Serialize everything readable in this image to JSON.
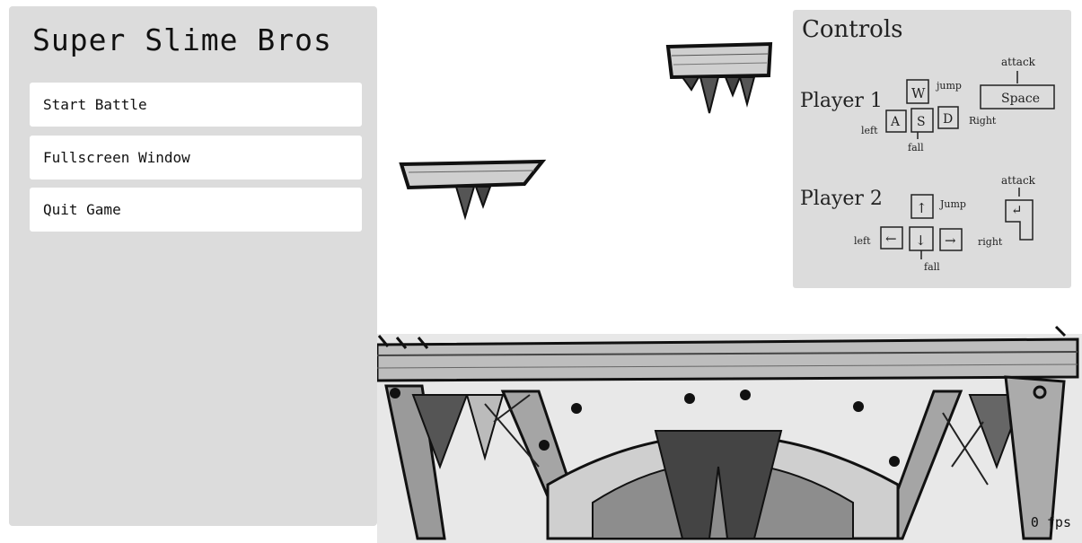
{
  "menu": {
    "title": "Super Slime Bros",
    "buttons": [
      {
        "label": "Start Battle"
      },
      {
        "label": "Fullscreen Window"
      },
      {
        "label": "Quit Game"
      }
    ]
  },
  "controls": {
    "title": "Controls",
    "player1": {
      "label": "Player 1",
      "keys": {
        "up": "W",
        "left": "A",
        "down": "S",
        "right": "D",
        "attack": "Space"
      },
      "annotations": {
        "jump": "jump",
        "left": "left",
        "right": "Right",
        "fall": "fall",
        "attack": "attack"
      }
    },
    "player2": {
      "label": "Player 2",
      "keys": {
        "up": "↑",
        "left": "←",
        "down": "↓",
        "right": "→",
        "attack": "↵"
      },
      "annotations": {
        "jump": "Jump",
        "left": "left",
        "right": "right",
        "fall": "fall",
        "attack": "attack"
      }
    }
  },
  "hud": {
    "fps_text": "0 fps"
  }
}
